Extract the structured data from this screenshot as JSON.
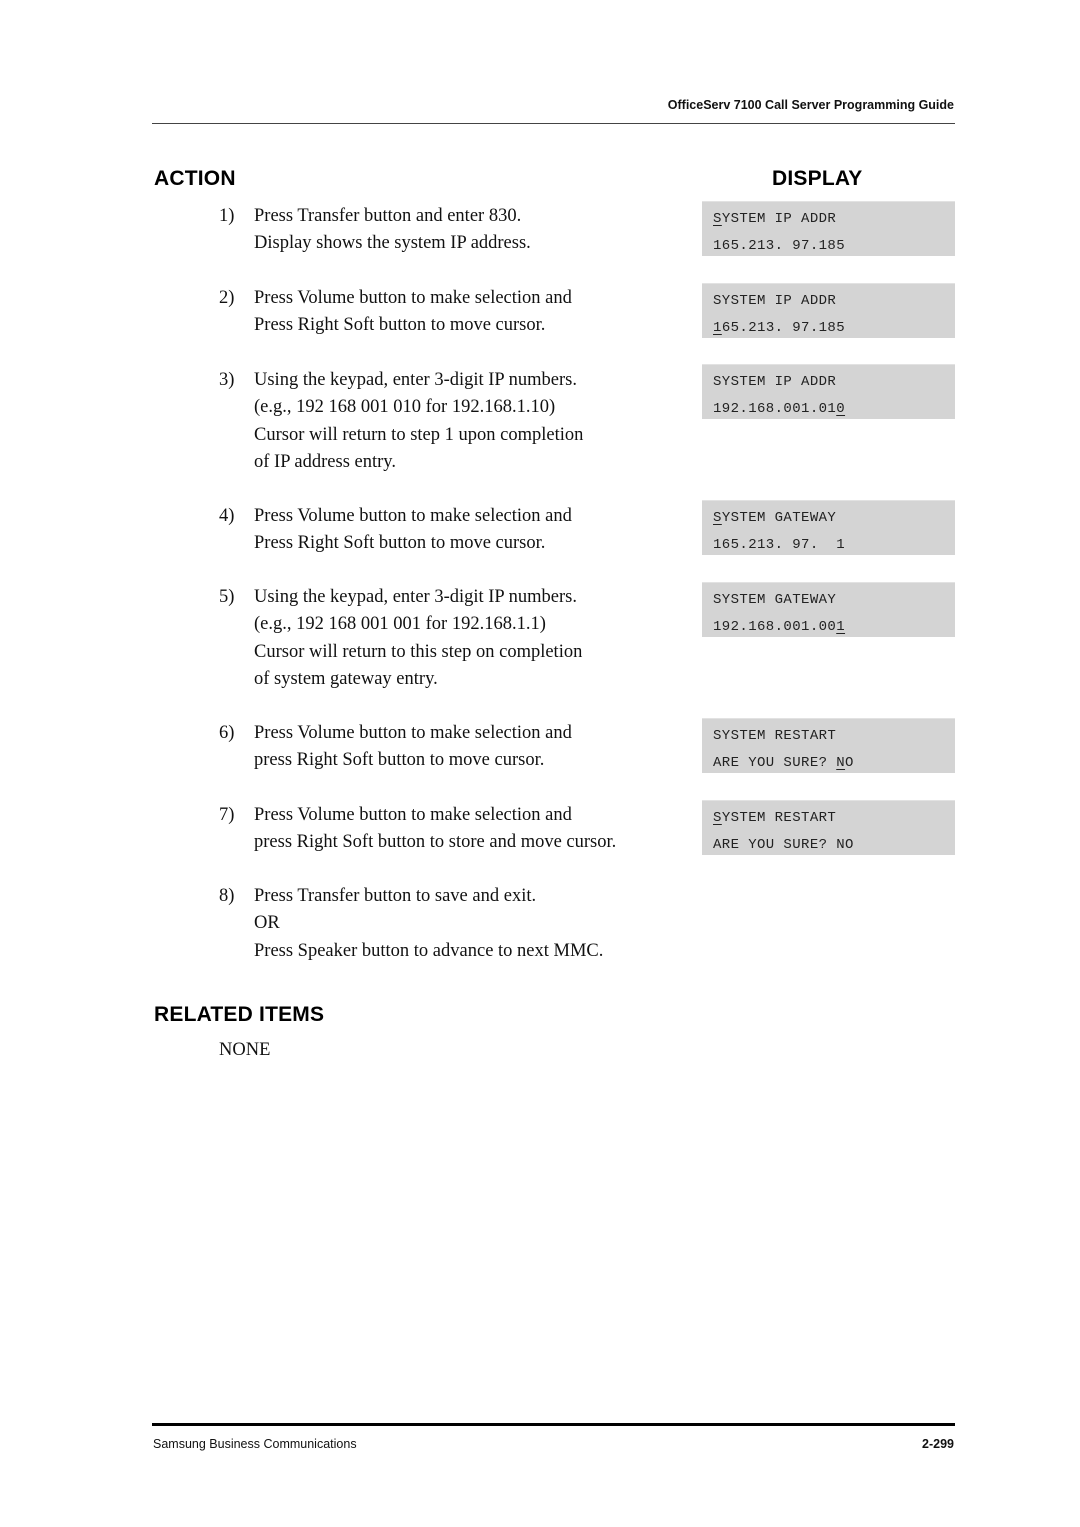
{
  "header": {
    "title": "OfficeServ 7100 Call Server Programming Guide"
  },
  "sections": {
    "action": "ACTION",
    "display": "DISPLAY",
    "related_items": "RELATED ITEMS"
  },
  "steps": [
    {
      "num": "1)",
      "lines": [
        "Press Transfer button and enter 830.",
        "Display shows the system IP address."
      ]
    },
    {
      "num": "2)",
      "lines": [
        "Press Volume button to make selection and",
        "Press Right Soft button to move cursor."
      ]
    },
    {
      "num": "3)",
      "lines": [
        "Using the keypad, enter 3-digit IP numbers.",
        "(e.g., 192 168 001 010 for 192.168.1.10)",
        "Cursor will return to step 1 upon completion",
        "of IP address entry."
      ]
    },
    {
      "num": "4)",
      "lines": [
        "Press Volume button to make selection and",
        "Press Right Soft button to move cursor."
      ]
    },
    {
      "num": "5)",
      "lines": [
        "Using the keypad, enter 3-digit IP numbers.",
        "(e.g., 192 168 001 001 for 192.168.1.1)",
        "Cursor will return to this step on completion",
        "of system gateway entry."
      ]
    },
    {
      "num": "6)",
      "lines": [
        "Press Volume button to make selection and",
        "press Right Soft button to move cursor."
      ]
    },
    {
      "num": "7)",
      "lines": [
        "Press Volume button to make selection and",
        "press Right Soft button to store and move cursor."
      ]
    },
    {
      "num": "8)",
      "lines": [
        "Press Transfer button to save and exit.",
        "OR",
        "Press Speaker button to advance to next MMC."
      ]
    }
  ],
  "displays": [
    {
      "row1": {
        "cursor": "S",
        "rest": "YSTEM IP ADDR"
      },
      "row2": {
        "text": "165.213. 97.185"
      }
    },
    {
      "row1": {
        "text": "SYSTEM IP ADDR"
      },
      "row2": {
        "cursor": "1",
        "rest": "65.213. 97.185"
      }
    },
    {
      "row1": {
        "text": "SYSTEM IP ADDR"
      },
      "row2": {
        "pre": "192.168.001.01",
        "cursor": "0"
      }
    },
    {
      "row1": {
        "cursor": "S",
        "rest": "YSTEM GATEWAY"
      },
      "row2": {
        "text": "165.213. 97.  1"
      }
    },
    {
      "row1": {
        "text": "SYSTEM GATEWAY"
      },
      "row2": {
        "pre": "192.168.001.00",
        "cursor": "1"
      }
    },
    {
      "row1": {
        "text": "SYSTEM RESTART"
      },
      "row2": {
        "pre": "ARE YOU SURE? ",
        "cursor": "N",
        "rest": "O"
      }
    },
    {
      "row1": {
        "cursor": "S",
        "rest": "YSTEM RESTART"
      },
      "row2": {
        "text": "ARE YOU SURE? NO"
      }
    }
  ],
  "related": {
    "value": "NONE"
  },
  "footer": {
    "company": "Samsung Business Communications",
    "page": "2-299"
  },
  "colors": {
    "lcd_background": "#d4d4d4",
    "text": "#111111"
  }
}
